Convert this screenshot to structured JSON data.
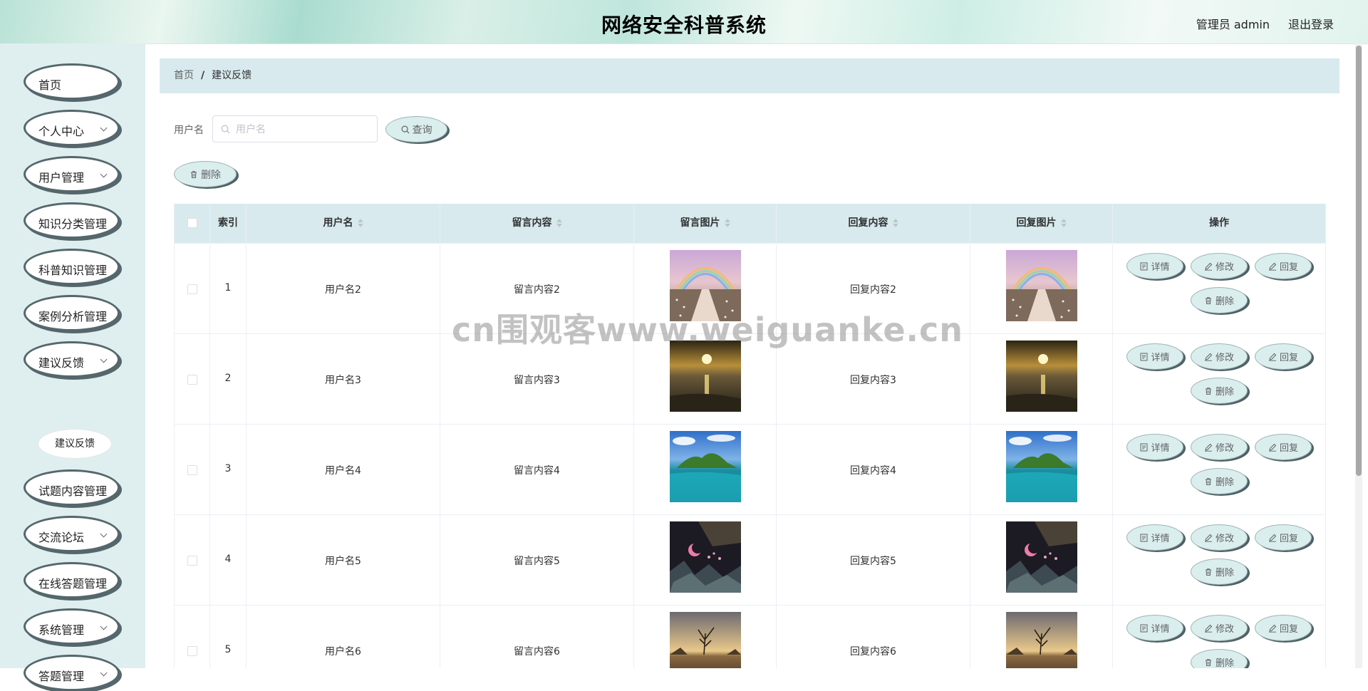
{
  "header": {
    "title": "网络安全科普系统",
    "user": "管理员 admin",
    "logout": "退出登录"
  },
  "sidebar": {
    "items": [
      {
        "label": "首页",
        "chevron": false
      },
      {
        "label": "个人中心",
        "chevron": true
      },
      {
        "label": "用户管理",
        "chevron": true
      },
      {
        "label": "知识分类管理",
        "chevron": false
      },
      {
        "label": "科普知识管理",
        "chevron": false
      },
      {
        "label": "案例分析管理",
        "chevron": false
      },
      {
        "label": "建议反馈",
        "chevron": true
      },
      {
        "label": "试题内容管理",
        "chevron": false
      },
      {
        "label": "交流论坛",
        "chevron": true
      },
      {
        "label": "在线答题管理",
        "chevron": false
      },
      {
        "label": "系统管理",
        "chevron": true
      },
      {
        "label": "答题管理",
        "chevron": true
      }
    ],
    "submenu": "建议反馈"
  },
  "breadcrumb": {
    "home": "首页",
    "separator": "/",
    "current": "建议反馈"
  },
  "search": {
    "label": "用户名",
    "placeholder": "用户名",
    "query_label": "查询"
  },
  "toolbar": {
    "delete_label": "删除"
  },
  "table": {
    "headers": [
      "索引",
      "用户名",
      "留言内容",
      "留言图片",
      "回复内容",
      "回复图片",
      "操作"
    ],
    "rows": [
      {
        "index": "1",
        "username": "用户名2",
        "message": "留言内容2",
        "reply": "回复内容2",
        "image": "rainbow-path-image"
      },
      {
        "index": "2",
        "username": "用户名3",
        "message": "留言内容3",
        "reply": "回复内容3",
        "image": "sunset-sea-image"
      },
      {
        "index": "3",
        "username": "用户名4",
        "message": "留言内容4",
        "reply": "回复内容4",
        "image": "island-lagoon-image"
      },
      {
        "index": "4",
        "username": "用户名5",
        "message": "留言内容5",
        "reply": "回复内容5",
        "image": "night-moon-image"
      },
      {
        "index": "5",
        "username": "用户名6",
        "message": "留言内容6",
        "reply": "回复内容6",
        "image": "lake-tree-image"
      }
    ],
    "actions": {
      "detail": "详情",
      "edit": "修改",
      "reply": "回复",
      "delete": "删除"
    }
  },
  "watermark": "cn围观客www.weiguanke.cn"
}
